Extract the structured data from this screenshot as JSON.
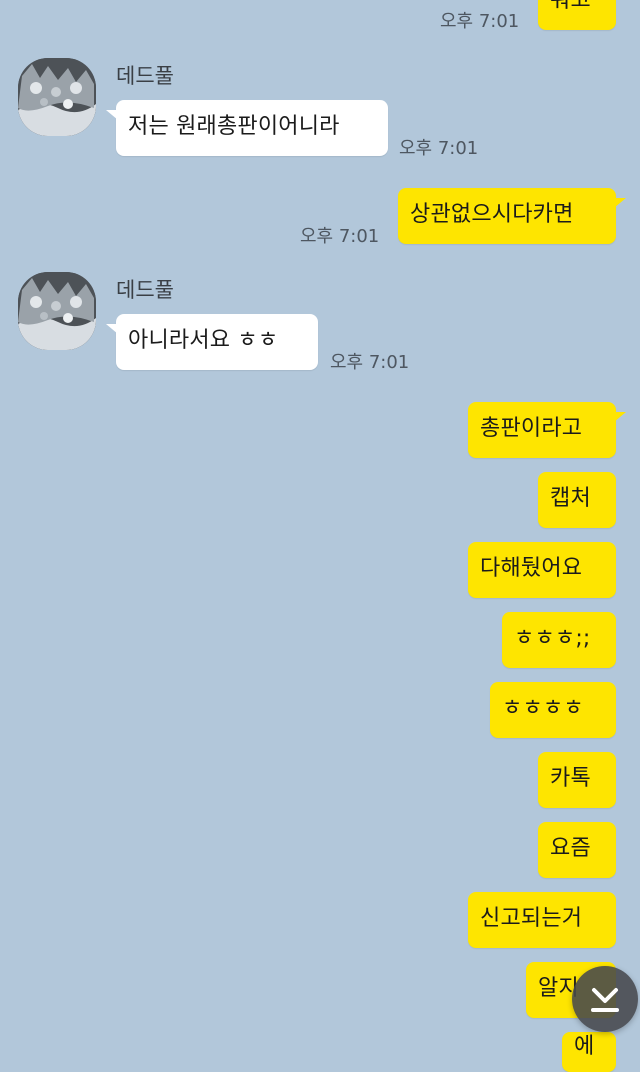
{
  "chat": {
    "sender_name": "데드풀",
    "messages": [
      {
        "text": "줘고",
        "time": "오후 7:01"
      },
      {
        "text": "저는 원래총판이어니라",
        "time": "오후 7:01"
      },
      {
        "text": "상관없으시다카면",
        "time": "오후 7:01"
      },
      {
        "text": "아니라서요 ㅎㅎ",
        "time": "오후 7:01"
      },
      {
        "text": "총판이라고"
      },
      {
        "text": "캡처"
      },
      {
        "text": "다해뒀어요"
      },
      {
        "text": "ㅎㅎㅎ;;"
      },
      {
        "text": "ㅎㅎㅎㅎ"
      },
      {
        "text": "카톡"
      },
      {
        "text": "요즘"
      },
      {
        "text": "신고되는거"
      },
      {
        "text": "알지"
      },
      {
        "text": "에"
      }
    ]
  },
  "icons": {
    "avatar": "profile-photo-avatar",
    "scroll": "scroll-to-bottom-icon"
  },
  "colors": {
    "background": "#b2c7da",
    "my_bubble": "#fee500",
    "other_bubble": "#ffffff"
  }
}
